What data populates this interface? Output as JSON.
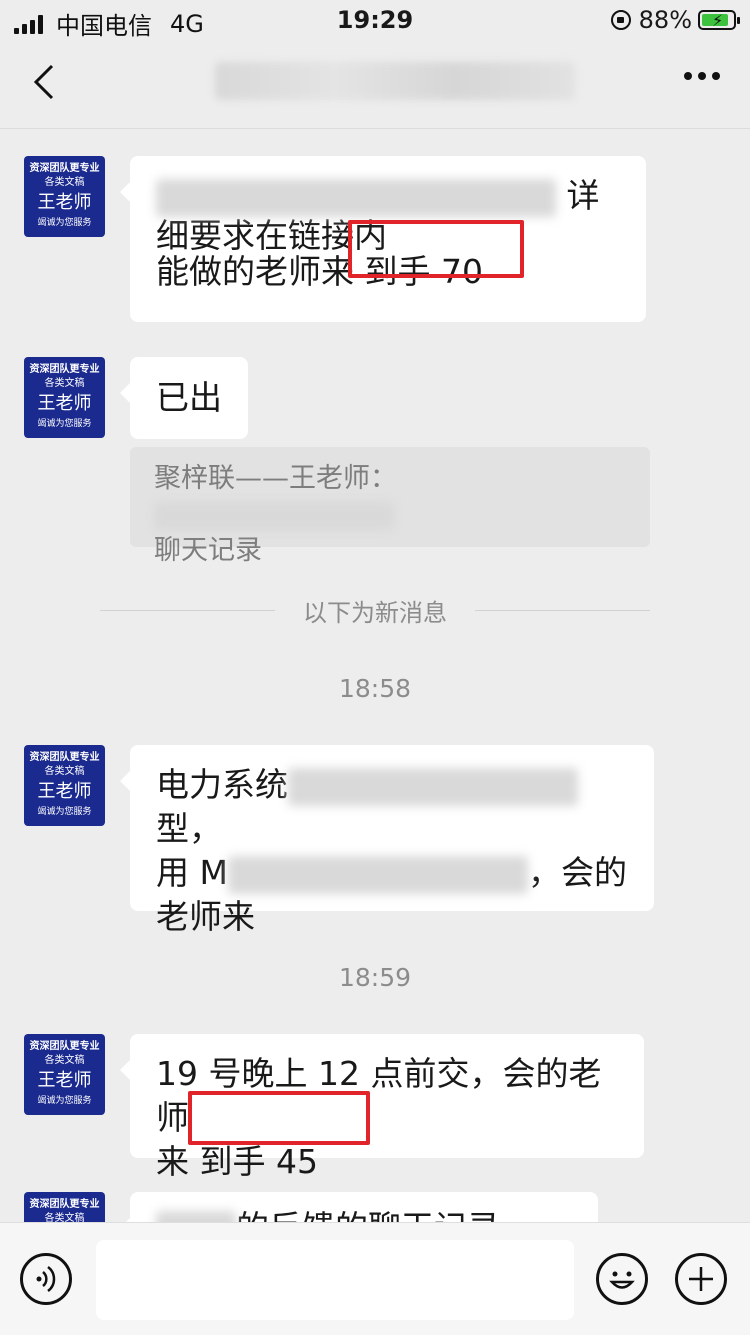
{
  "status": {
    "carrier": "中国电信",
    "network": "4G",
    "time": "19:29",
    "battery": "88%",
    "battery_level": 0.88
  },
  "nav": {
    "back_icon": "chevron-left-icon",
    "more_icon": "more-icon"
  },
  "avatar": {
    "line1": "资深团队更专业",
    "line2": "各类文稿",
    "name": "王老师",
    "line4": "竭诚为您服务"
  },
  "messages": {
    "m1": {
      "tail": "详",
      "line2": "细要求在链接内",
      "line3_a": "能做的老师来",
      "line3_b": "到手 70"
    },
    "m2": {
      "text": "已出"
    },
    "quote": {
      "line1": "聚梓联——王老师：",
      "line2": "聊天记录"
    },
    "m3": {
      "line1_a": "电力系统",
      "line1_b": "型，",
      "line2_a": "用 M",
      "line2_b": "，会的",
      "line3": "老师来"
    },
    "m4": {
      "line1": "19 号晚上 12 点前交，会的老师",
      "line2_a": "来",
      "line2_b": "到手 45"
    },
    "m5": {
      "text": "的反馈的聊天记录"
    }
  },
  "divider": {
    "text": "以下为新消息"
  },
  "times": {
    "t1": "18:58",
    "t2": "18:59"
  },
  "colors": {
    "avatar_bg": "#1b2a8f",
    "highlight_red": "#e0242a",
    "chat_bg": "#ededed"
  }
}
